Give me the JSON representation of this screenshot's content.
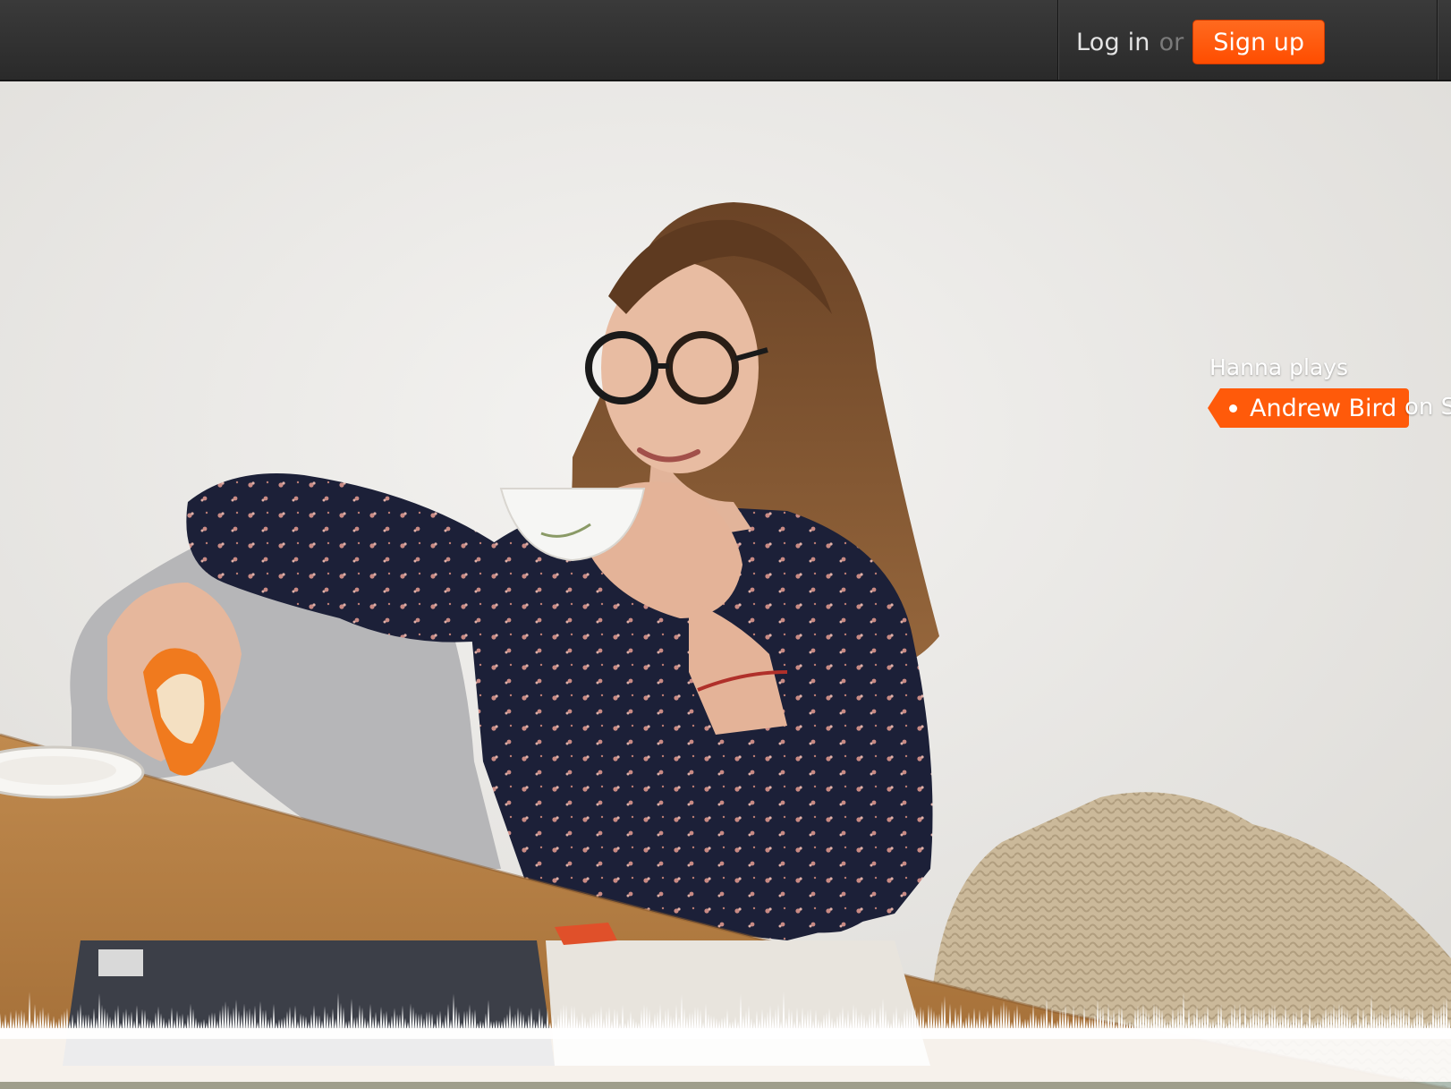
{
  "header": {
    "login_label": "Log in",
    "or_label": "or",
    "signup_label": "Sign up"
  },
  "hero": {
    "caption_intro": "Hanna plays",
    "artist_label": "Andrew Bird",
    "caption_suffix": "on S"
  },
  "colors": {
    "accent": "#ff5500",
    "topbar": "#333333",
    "waveform": "#ffffff"
  }
}
